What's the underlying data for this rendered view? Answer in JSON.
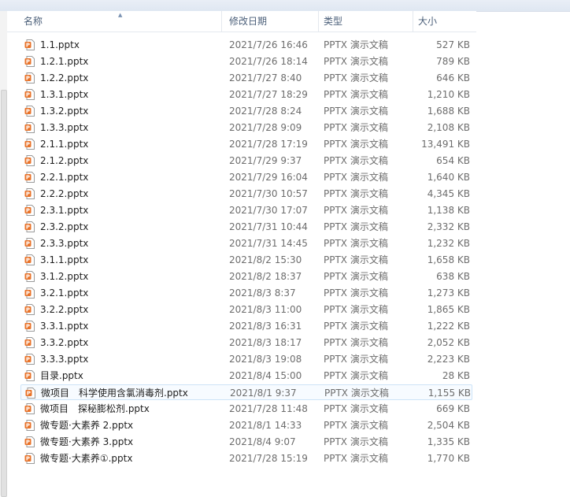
{
  "columns": {
    "name": "名称",
    "date": "修改日期",
    "type": "类型",
    "size": "大小"
  },
  "colors": {
    "header_text": "#4c607a",
    "icon_orange": "#e8732a",
    "hover_border": "#cde3f7"
  },
  "icon": "pptx-file-icon",
  "files": [
    {
      "name": "1.1.pptx",
      "date": "2021/7/26 16:46",
      "type": "PPTX 演示文稿",
      "size": "527 KB"
    },
    {
      "name": "1.2.1.pptx",
      "date": "2021/7/26 18:14",
      "type": "PPTX 演示文稿",
      "size": "789 KB"
    },
    {
      "name": "1.2.2.pptx",
      "date": "2021/7/27 8:40",
      "type": "PPTX 演示文稿",
      "size": "646 KB"
    },
    {
      "name": "1.3.1.pptx",
      "date": "2021/7/27 18:29",
      "type": "PPTX 演示文稿",
      "size": "1,210 KB"
    },
    {
      "name": "1.3.2.pptx",
      "date": "2021/7/28 8:24",
      "type": "PPTX 演示文稿",
      "size": "1,688 KB"
    },
    {
      "name": "1.3.3.pptx",
      "date": "2021/7/28 9:09",
      "type": "PPTX 演示文稿",
      "size": "2,108 KB"
    },
    {
      "name": "2.1.1.pptx",
      "date": "2021/7/28 17:19",
      "type": "PPTX 演示文稿",
      "size": "13,491 KB"
    },
    {
      "name": "2.1.2.pptx",
      "date": "2021/7/29 9:37",
      "type": "PPTX 演示文稿",
      "size": "654 KB"
    },
    {
      "name": "2.2.1.pptx",
      "date": "2021/7/29 16:04",
      "type": "PPTX 演示文稿",
      "size": "1,640 KB"
    },
    {
      "name": "2.2.2.pptx",
      "date": "2021/7/30 10:57",
      "type": "PPTX 演示文稿",
      "size": "4,345 KB"
    },
    {
      "name": "2.3.1.pptx",
      "date": "2021/7/30 17:07",
      "type": "PPTX 演示文稿",
      "size": "1,138 KB"
    },
    {
      "name": "2.3.2.pptx",
      "date": "2021/7/31 10:44",
      "type": "PPTX 演示文稿",
      "size": "2,332 KB"
    },
    {
      "name": "2.3.3.pptx",
      "date": "2021/7/31 14:45",
      "type": "PPTX 演示文稿",
      "size": "1,232 KB"
    },
    {
      "name": "3.1.1.pptx",
      "date": "2021/8/2 15:30",
      "type": "PPTX 演示文稿",
      "size": "1,658 KB"
    },
    {
      "name": "3.1.2.pptx",
      "date": "2021/8/2 18:37",
      "type": "PPTX 演示文稿",
      "size": "638 KB"
    },
    {
      "name": "3.2.1.pptx",
      "date": "2021/8/3 8:37",
      "type": "PPTX 演示文稿",
      "size": "1,273 KB"
    },
    {
      "name": "3.2.2.pptx",
      "date": "2021/8/3 11:00",
      "type": "PPTX 演示文稿",
      "size": "1,865 KB"
    },
    {
      "name": "3.3.1.pptx",
      "date": "2021/8/3 16:31",
      "type": "PPTX 演示文稿",
      "size": "1,222 KB"
    },
    {
      "name": "3.3.2.pptx",
      "date": "2021/8/3 18:17",
      "type": "PPTX 演示文稿",
      "size": "2,052 KB"
    },
    {
      "name": "3.3.3.pptx",
      "date": "2021/8/3 19:08",
      "type": "PPTX 演示文稿",
      "size": "2,223 KB"
    },
    {
      "name": "目录.pptx",
      "date": "2021/8/4 15:00",
      "type": "PPTX 演示文稿",
      "size": "28 KB"
    },
    {
      "name": "微项目　科学使用含氯消毒剂.pptx",
      "date": "2021/8/1 9:37",
      "type": "PPTX 演示文稿",
      "size": "1,155 KB",
      "hover": true
    },
    {
      "name": "微项目　探秘膨松剂.pptx",
      "date": "2021/7/28 11:48",
      "type": "PPTX 演示文稿",
      "size": "669 KB"
    },
    {
      "name": "微专题·大素养 2.pptx",
      "date": "2021/8/1 14:33",
      "type": "PPTX 演示文稿",
      "size": "2,504 KB"
    },
    {
      "name": "微专题·大素养 3.pptx",
      "date": "2021/8/4 9:07",
      "type": "PPTX 演示文稿",
      "size": "1,335 KB"
    },
    {
      "name": "微专题·大素养①.pptx",
      "date": "2021/7/28 15:19",
      "type": "PPTX 演示文稿",
      "size": "1,770 KB"
    }
  ]
}
